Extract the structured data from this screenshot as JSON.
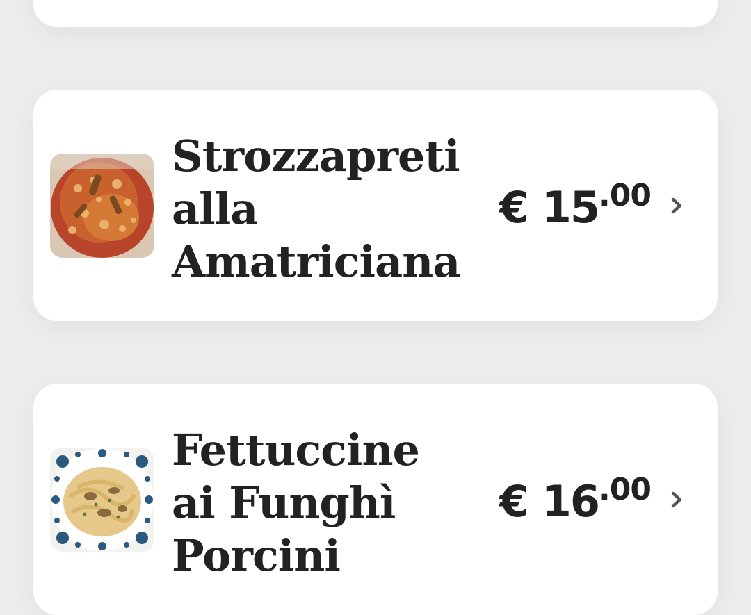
{
  "menu_items": [
    {
      "name_lines": [
        "Strozzapreti",
        "alla",
        "Amatriciana"
      ],
      "price_main": "€ 15",
      "price_cents": ".00",
      "image_icon": "pasta-amatriciana-photo"
    },
    {
      "name_lines": [
        "Fettuccine",
        "ai Funghì",
        "Porcini"
      ],
      "price_main": "€ 16",
      "price_cents": ".00",
      "image_icon": "pasta-funghi-porcini-photo"
    }
  ],
  "colors": {
    "background": "#ededed",
    "card": "#ffffff",
    "text": "#222222",
    "chevron": "#555555"
  }
}
